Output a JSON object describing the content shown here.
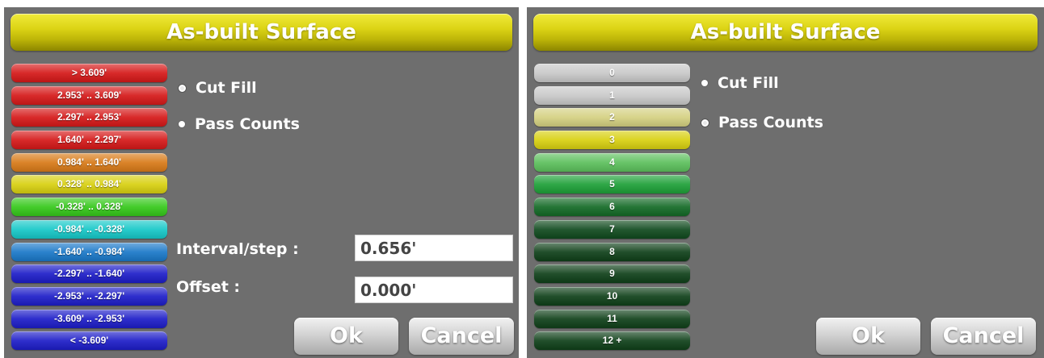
{
  "left_panel": {
    "title": "As-built Surface",
    "legend": [
      {
        "label": "> 3.609'",
        "color": "#d51818"
      },
      {
        "label": "2.953' .. 3.609'",
        "color": "#d51818"
      },
      {
        "label": "2.297' .. 2.953'",
        "color": "#d51818"
      },
      {
        "label": "1.640' .. 2.297'",
        "color": "#d51818"
      },
      {
        "label": "0.984' .. 1.640'",
        "color": "#d87a18"
      },
      {
        "label": "0.328' .. 0.984'",
        "color": "#d8d010"
      },
      {
        "label": "-0.328' .. 0.328'",
        "color": "#35c81a"
      },
      {
        "label": "-0.984' .. -0.328'",
        "color": "#16c8c8"
      },
      {
        "label": "-1.640' .. -0.984'",
        "color": "#1a78c8"
      },
      {
        "label": "-2.297' .. -1.640'",
        "color": "#1d1dc8"
      },
      {
        "label": "-2.953' .. -2.297'",
        "color": "#1d1dc8"
      },
      {
        "label": "-3.609' .. -2.953'",
        "color": "#1d1dc8"
      },
      {
        "label": "< -3.609'",
        "color": "#1d1dc8"
      }
    ],
    "options": {
      "cut_fill": "Cut Fill",
      "pass_counts": "Pass Counts",
      "selected": "cut_fill"
    },
    "interval_label": "Interval/step :",
    "interval_value": "0.656'",
    "offset_label": "Offset :",
    "offset_value": "0.000'",
    "ok_label": "Ok",
    "cancel_label": "Cancel"
  },
  "right_panel": {
    "title": "As-built Surface",
    "legend": [
      {
        "label": "0",
        "color": "#c8c8c8"
      },
      {
        "label": "1",
        "color": "#c8c8c8"
      },
      {
        "label": "2",
        "color": "#d4d080"
      },
      {
        "label": "3",
        "color": "#d8d010"
      },
      {
        "label": "4",
        "color": "#5cc05c"
      },
      {
        "label": "5",
        "color": "#1ea038"
      },
      {
        "label": "6",
        "color": "#136a26"
      },
      {
        "label": "7",
        "color": "#104a1e"
      },
      {
        "label": "8",
        "color": "#0f4019"
      },
      {
        "label": "9",
        "color": "#0f4019"
      },
      {
        "label": "10",
        "color": "#0f4019"
      },
      {
        "label": "11",
        "color": "#0f4019"
      },
      {
        "label": "12 +",
        "color": "#0f4019"
      }
    ],
    "options": {
      "cut_fill": "Cut Fill",
      "pass_counts": "Pass Counts",
      "selected": "pass_counts"
    },
    "ok_label": "Ok",
    "cancel_label": "Cancel"
  }
}
